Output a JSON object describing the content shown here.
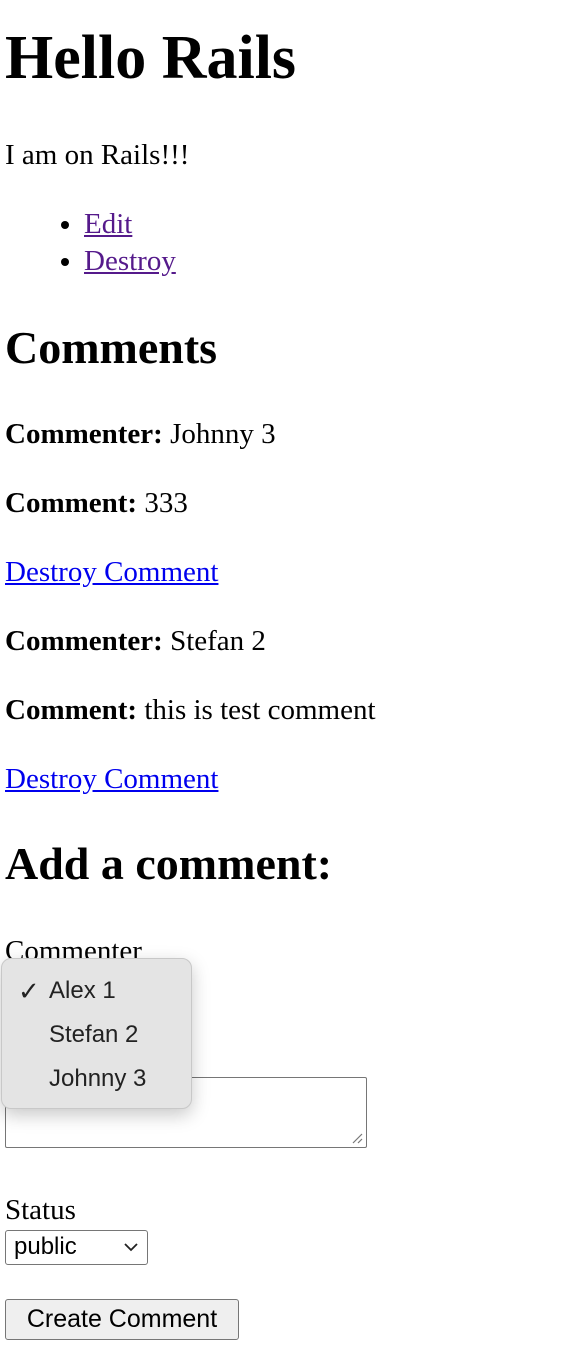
{
  "page": {
    "title": "Hello Rails",
    "intro": "I am on Rails!!!"
  },
  "actions": {
    "edit_label": "Edit",
    "destroy_label": "Destroy"
  },
  "comments_section": {
    "heading": "Comments",
    "commenter_label": "Commenter:",
    "comment_label": "Comment:",
    "destroy_comment_label": "Destroy Comment",
    "items": [
      {
        "commenter": "Johnny 3",
        "body": "333"
      },
      {
        "commenter": "Stefan 2",
        "body": "this is test comment"
      }
    ]
  },
  "form": {
    "heading": "Add a comment:",
    "commenter_label": "Commenter",
    "commenter_options": [
      "Alex 1",
      "Stefan 2",
      "Johnny 3"
    ],
    "commenter_selected": "Alex 1",
    "checkmark": "✓",
    "status_label": "Status",
    "status_value": "public",
    "submit_label": "Create Comment"
  },
  "colors": {
    "visited_link": "#551a8b",
    "link": "#0000ee",
    "dropdown_bg": "#e4e4e4",
    "button_bg": "#efefef"
  },
  "icons": {
    "dropdown_check": "check-icon",
    "select_arrow": "chevron-down-icon",
    "textarea_resize": "resize-grip-icon"
  }
}
